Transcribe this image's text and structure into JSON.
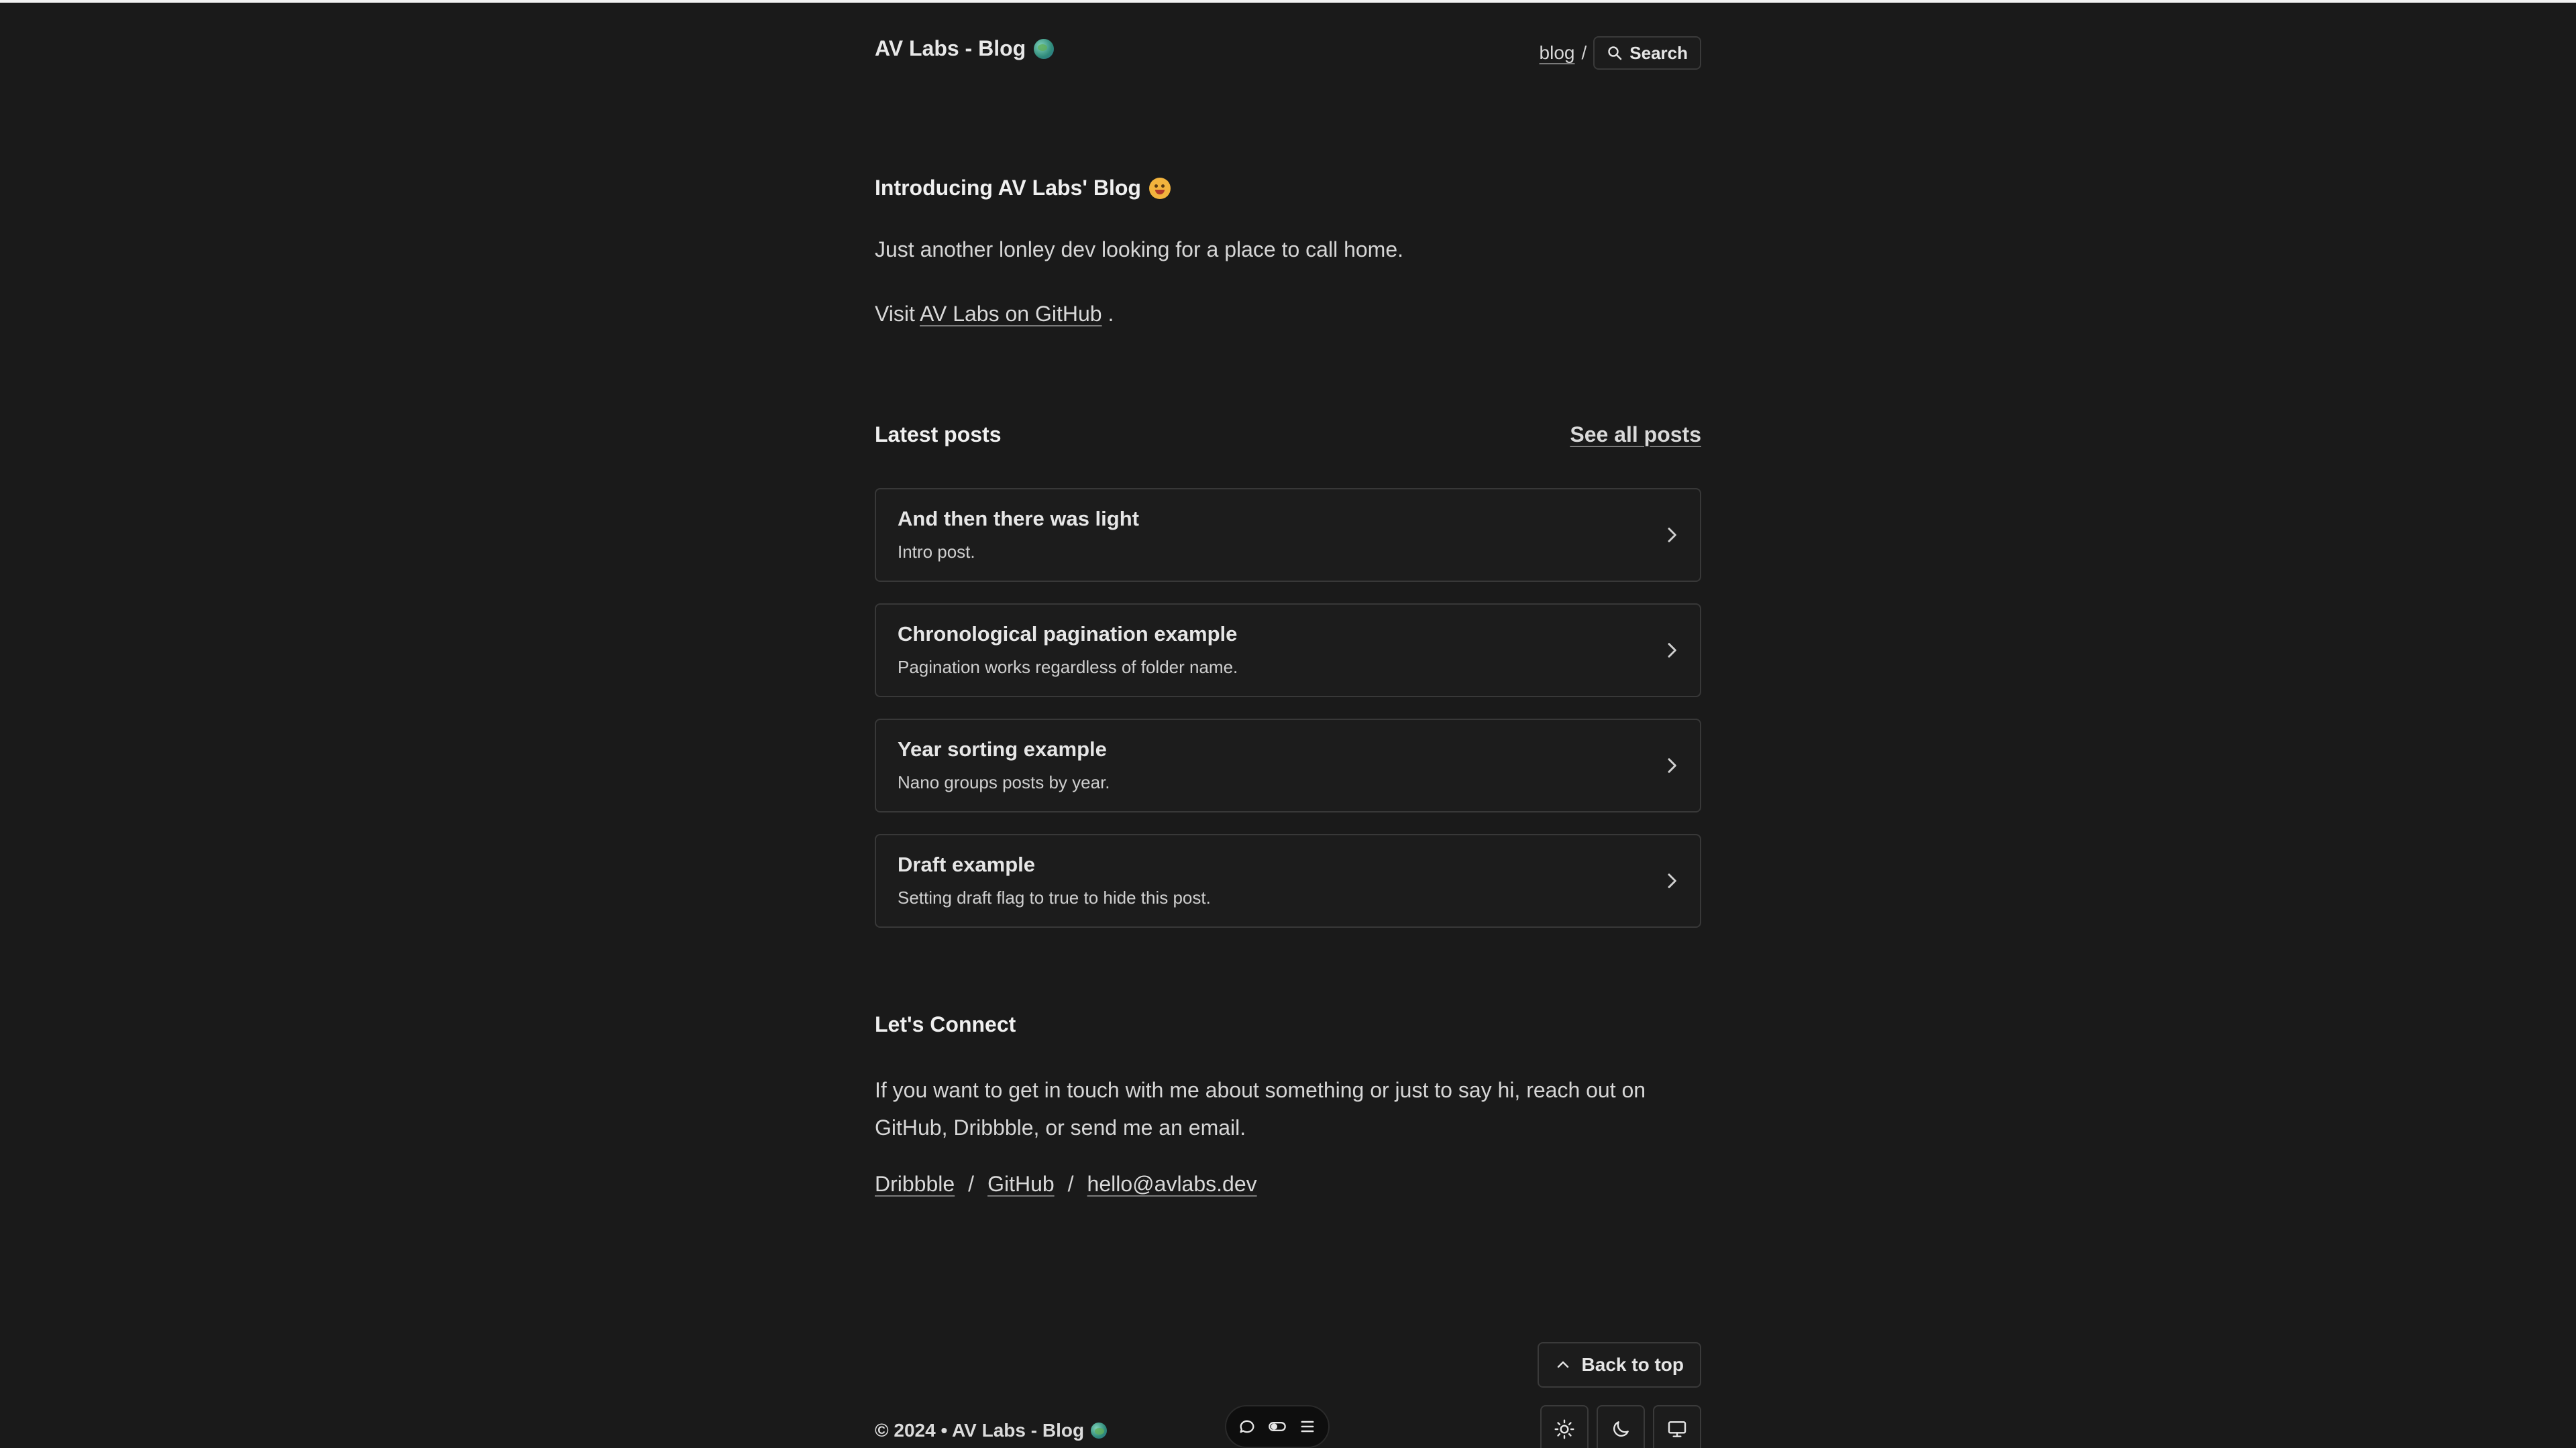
{
  "header": {
    "site_title": "AV Labs - Blog",
    "nav_blog": "blog",
    "nav_sep": "/",
    "search_label": "Search"
  },
  "intro": {
    "title": "Introducing AV Labs' Blog",
    "text": "Just another lonley dev looking for a place to call home.",
    "visit_prefix": "Visit",
    "visit_link": "AV Labs on GitHub",
    "visit_suffix": "."
  },
  "latest": {
    "title": "Latest posts",
    "see_all": "See all posts",
    "posts": [
      {
        "title": "And then there was light",
        "desc": "Intro post."
      },
      {
        "title": "Chronological pagination example",
        "desc": "Pagination works regardless of folder name."
      },
      {
        "title": "Year sorting example",
        "desc": "Nano groups posts by year."
      },
      {
        "title": "Draft example",
        "desc": "Setting draft flag to true to hide this post."
      }
    ]
  },
  "connect": {
    "title": "Let's Connect",
    "text": "If you want to get in touch with me about something or just to say hi, reach out on GitHub, Dribbble, or send me an email.",
    "links": [
      "Dribbble",
      "GitHub",
      "hello@avlabs.dev"
    ],
    "sep": "/"
  },
  "footer": {
    "back_to_top": "Back to top",
    "copyright": "© 2024 • AV Labs - Blog"
  },
  "icons": {
    "search": "search-icon",
    "chevron": "chevron-right-icon",
    "up": "chevron-up-icon",
    "sun": "sun-icon",
    "moon": "moon-icon",
    "monitor": "monitor-icon",
    "chat": "chat-icon",
    "toggle": "toggle-icon",
    "menu": "menu-icon"
  },
  "colors": {
    "background": "#1a1a1a",
    "text": "#e6e6e6",
    "border": "#383838"
  }
}
